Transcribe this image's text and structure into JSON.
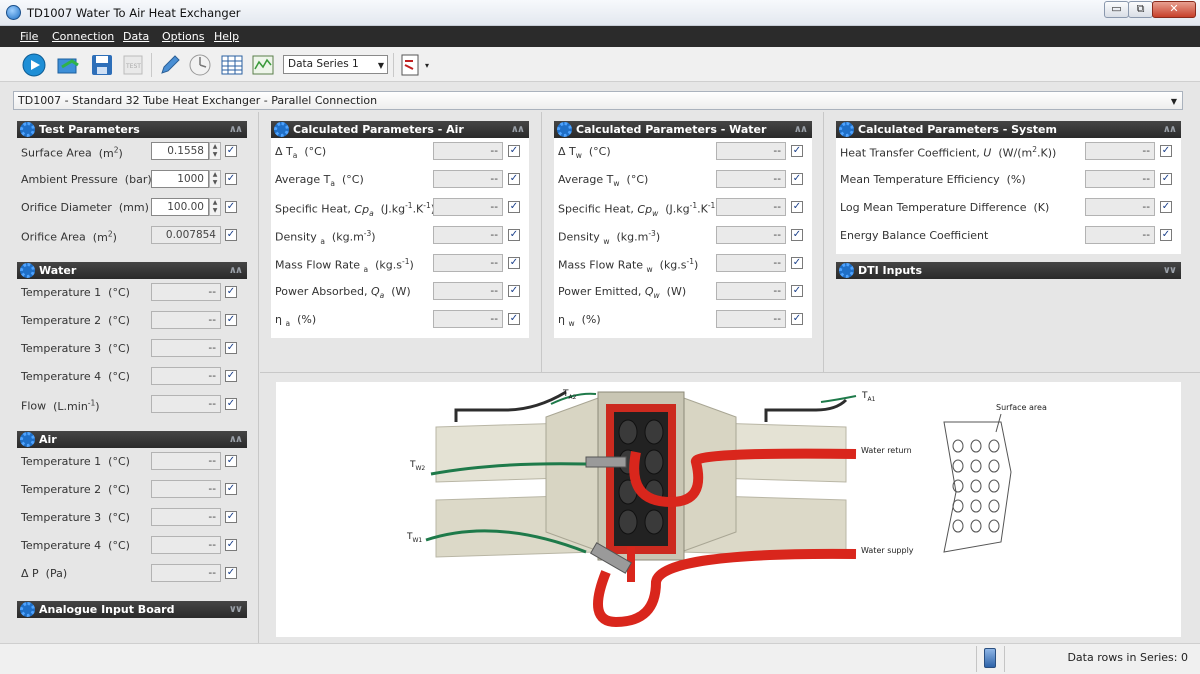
{
  "window": {
    "title": "TD1007 Water To Air Heat Exchanger",
    "minimize": "▭",
    "restore": "⧉",
    "close": "✕"
  },
  "menu": [
    "File",
    "Connection",
    "Data",
    "Options",
    "Help"
  ],
  "toolbar": {
    "series": "Data Series 1",
    "icons": [
      "play-icon",
      "open-icon",
      "save-icon",
      "test-icon",
      "pencil-icon",
      "timer-icon",
      "table-icon",
      "chart-icon",
      "diagram-icon"
    ]
  },
  "config": {
    "selected": "TD1007 - Standard 32 Tube Heat Exchanger - Parallel Connection"
  },
  "test_parameters": {
    "title": "Test Parameters",
    "rows": [
      {
        "label": "Surface Area",
        "unit": "m",
        "sup": "2",
        "value": "0.1558"
      },
      {
        "label": "Ambient Pressure",
        "unit": "bar",
        "value": "1000"
      },
      {
        "label": "Orifice Diameter",
        "unit": "mm",
        "value": "100.00"
      },
      {
        "label": "Orifice Area",
        "unit": "m",
        "sup": "2",
        "value": "0.007854"
      }
    ]
  },
  "water": {
    "title": "Water",
    "rows": [
      {
        "label": "Temperature 1",
        "unit": "°C",
        "value": "--"
      },
      {
        "label": "Temperature 2",
        "unit": "°C",
        "value": "--"
      },
      {
        "label": "Temperature 3",
        "unit": "°C",
        "value": "--"
      },
      {
        "label": "Temperature 4",
        "unit": "°C",
        "value": "--"
      },
      {
        "label": "Flow",
        "unit": "L.min",
        "sup": "-1",
        "value": "--"
      }
    ]
  },
  "air": {
    "title": "Air",
    "rows": [
      {
        "label": "Temperature 1",
        "unit": "°C",
        "value": "--"
      },
      {
        "label": "Temperature 2",
        "unit": "°C",
        "value": "--"
      },
      {
        "label": "Temperature 3",
        "unit": "°C",
        "value": "--"
      },
      {
        "label": "Temperature 4",
        "unit": "°C",
        "value": "--"
      },
      {
        "label": "Δ P",
        "unit": "Pa",
        "value": "--"
      }
    ]
  },
  "analogue": {
    "title": "Analogue Input Board"
  },
  "calc_air": {
    "title": "Calculated Parameters - Air",
    "rows": [
      {
        "html": "Δ T<sub>a</sub>&nbsp; (°C)",
        "value": "--"
      },
      {
        "html": "Average T<sub>a</sub>&nbsp; (°C)",
        "value": "--"
      },
      {
        "html": "Specific Heat, <i>Cp<sub>a</sub></i>&nbsp; (J.kg<sup>-1</sup>.K<sup>-1</sup>)",
        "value": "--"
      },
      {
        "html": "Density <sub>a</sub>&nbsp; (kg.m<sup>-3</sup>)",
        "value": "--"
      },
      {
        "html": "Mass Flow Rate <sub>a</sub>&nbsp; (kg.s<sup>-1</sup>)",
        "value": "--"
      },
      {
        "html": "Power Absorbed, <i>Q<sub>a</sub></i>&nbsp; (W)",
        "value": "--"
      },
      {
        "html": "η <sub>a</sub>&nbsp; (%)",
        "value": "--"
      }
    ]
  },
  "calc_water": {
    "title": "Calculated Parameters - Water",
    "rows": [
      {
        "html": "Δ T<sub>w</sub>&nbsp; (°C)",
        "value": "--"
      },
      {
        "html": "Average T<sub>w</sub>&nbsp; (°C)",
        "value": "--"
      },
      {
        "html": "Specific Heat, <i>Cp<sub>w</sub></i>&nbsp; (J.kg<sup>-1</sup>.K<sup>-1</sup>)",
        "value": "--"
      },
      {
        "html": "Density <sub>w</sub>&nbsp; (kg.m<sup>-3</sup>)",
        "value": "--"
      },
      {
        "html": "Mass Flow Rate <sub>w</sub>&nbsp; (kg.s<sup>-1</sup>)",
        "value": "--"
      },
      {
        "html": "Power Emitted, <i>Q<sub>w</sub></i>&nbsp; (W)",
        "value": "--"
      },
      {
        "html": "η <sub>w</sub>&nbsp; (%)",
        "value": "--"
      }
    ]
  },
  "calc_system": {
    "title": "Calculated Parameters - System",
    "rows": [
      {
        "html": "Heat Transfer Coefficient, <i>U</i>&nbsp; (W/(m<sup>2</sup>.K))",
        "value": "--"
      },
      {
        "html": "Mean Temperature Efficiency&nbsp; (%)",
        "value": "--"
      },
      {
        "html": "Log Mean Temperature Difference&nbsp; (K)",
        "value": "--"
      },
      {
        "html": "Energy Balance Coefficient",
        "value": "--"
      }
    ]
  },
  "dti": {
    "title": "DTI Inputs"
  },
  "diagram": {
    "ta2": "T",
    "ta2_sub": "A2",
    "ta1": "T",
    "ta1_sub": "A1",
    "tw2": "T",
    "tw2_sub": "W2",
    "tw1": "T",
    "tw1_sub": "W1",
    "water_return": "Water return",
    "water_supply": "Water supply",
    "surface_area": "Surface area"
  },
  "status": {
    "rows_text": "Data rows in Series: 0"
  },
  "colors": {
    "header": "#333333",
    "accent": "#1f6fc7",
    "hose": "#d9261c",
    "duct": "#e4e2d4"
  }
}
